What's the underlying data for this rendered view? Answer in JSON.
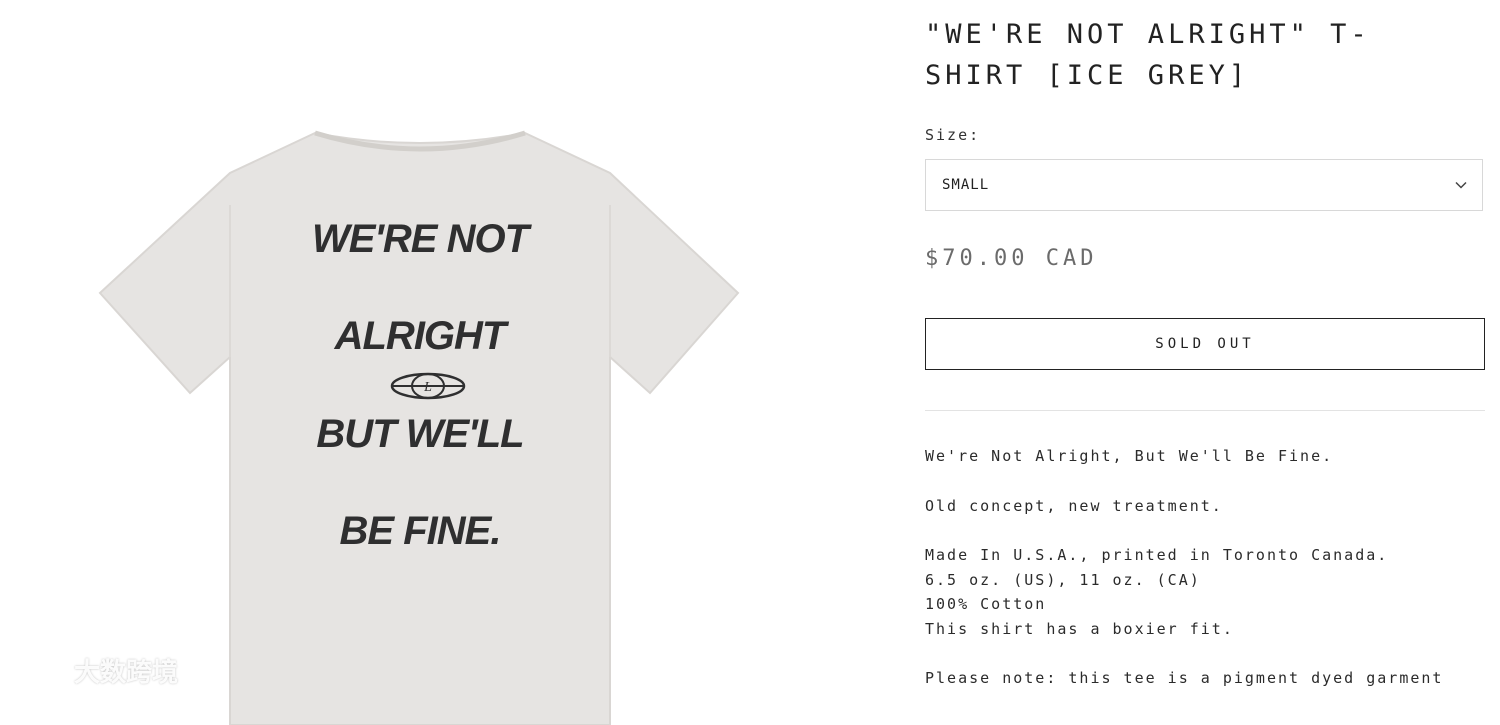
{
  "product": {
    "title": "\"WE'RE NOT ALRIGHT\" T-SHIRT [ICE GREY]",
    "size_label": "Size:",
    "size_selected": "SMALL",
    "price": "$70.00 CAD",
    "button_label": "SOLD OUT",
    "description": {
      "tagline": "We're Not Alright, But We'll Be Fine.",
      "concept": "Old concept, new treatment.",
      "details": [
        "Made In U.S.A., printed in Toronto Canada.",
        "6.5 oz. (US), 11 oz. (CA)",
        "100% Cotton",
        "This shirt has a boxier fit."
      ],
      "note": "Please note: this tee is a pigment dyed garment"
    }
  },
  "shirt_print": {
    "lines": [
      "WE'RE NOT",
      "ALRIGHT",
      "BUT WE'LL",
      "BE FINE."
    ],
    "shirt_color": "#e6e4e2",
    "ink_color": "#2f2f30"
  },
  "watermark": {
    "text": "大数跨境"
  },
  "icons": {
    "select_chevron": "chevron-down-icon",
    "print_logo": "globe-logo-icon",
    "watermark_logo": "watermark-logo-icon"
  }
}
